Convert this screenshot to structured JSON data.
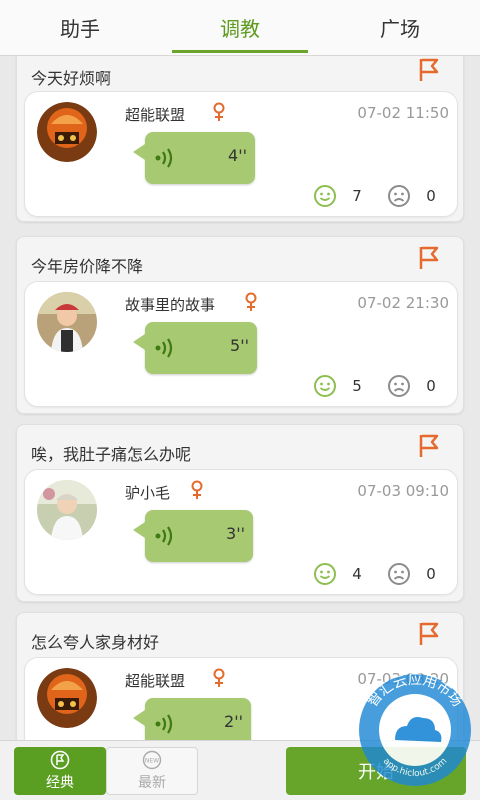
{
  "tabs": [
    {
      "label": "助手"
    },
    {
      "label": "调教"
    },
    {
      "label": "广场"
    }
  ],
  "posts": [
    {
      "title": "今天好烦啊",
      "user": "超能联盟",
      "time": "07-02 11:50",
      "duration": "4''",
      "likes": "7",
      "dislikes": "0",
      "avatar_icon": "orange-helmet-avatar"
    },
    {
      "title": "今年房价降不降",
      "user": "故事里的故事",
      "time": "07-02 21:30",
      "duration": "5''",
      "likes": "5",
      "dislikes": "0",
      "avatar_icon": "person-photo-avatar"
    },
    {
      "title": "唉，我肚子痛怎么办呢",
      "user": "驴小毛",
      "time": "07-03 09:10",
      "duration": "3''",
      "likes": "4",
      "dislikes": "0",
      "avatar_icon": "person-photo-avatar"
    },
    {
      "title": "怎么夸人家身材好",
      "user": "超能联盟",
      "time": "07-03 08:20",
      "duration": "2''",
      "likes": "",
      "dislikes": "",
      "avatar_icon": "orange-helmet-avatar"
    }
  ],
  "bottom": {
    "classic_label": "经典",
    "newest_label": "最新",
    "newest_badge": "NEW",
    "start_label": "开始"
  },
  "watermark": {
    "top_text": "智汇云应用市场",
    "bottom_text": "app.hiclout.com"
  },
  "colors": {
    "accent": "#67a52a",
    "bubble": "#a6c972",
    "flag": "#e46b2d",
    "female": "#e46b2d"
  }
}
